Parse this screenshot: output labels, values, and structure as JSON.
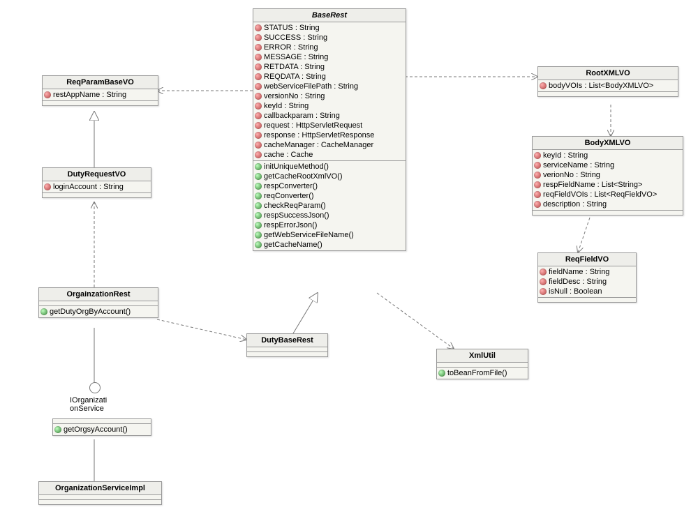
{
  "classes": {
    "BaseRest": {
      "name": "BaseRest",
      "italic": true,
      "attrs": [
        {
          "n": "STATUS",
          "t": "String"
        },
        {
          "n": "SUCCESS",
          "t": "String"
        },
        {
          "n": "ERROR",
          "t": "String"
        },
        {
          "n": "MESSAGE",
          "t": "String"
        },
        {
          "n": "RETDATA",
          "t": "String"
        },
        {
          "n": "REQDATA",
          "t": "String"
        },
        {
          "n": "webServiceFilePath",
          "t": "String"
        },
        {
          "n": "versionNo",
          "t": "String"
        },
        {
          "n": "keyId",
          "t": "String"
        },
        {
          "n": "callbackparam",
          "t": "String"
        },
        {
          "n": "request",
          "t": "HttpServletRequest"
        },
        {
          "n": "response",
          "t": "HttpServletResponse"
        },
        {
          "n": "cacheManager",
          "t": "CacheManager"
        },
        {
          "n": "cache",
          "t": "Cache"
        }
      ],
      "methods": [
        "initUniqueMethod()",
        "getCacheRootXmlVO()",
        "respConverter()",
        "reqConverter()",
        "checkReqParam()",
        "respSuccessJson()",
        "respErrorJson()",
        "getWebServiceFileName()",
        "getCacheName()"
      ]
    },
    "ReqParamBaseVO": {
      "name": "ReqParamBaseVO",
      "attrs": [
        {
          "n": "restAppName",
          "t": "String"
        }
      ],
      "methods": []
    },
    "DutyRequestVO": {
      "name": "DutyRequestVO",
      "attrs": [
        {
          "n": "loginAccount",
          "t": "String"
        }
      ],
      "methods": []
    },
    "OrgainzationRest": {
      "name": "OrgainzationRest",
      "attrs": [],
      "methods": [
        "getDutyOrgByAccount()"
      ]
    },
    "DutyBaseRest": {
      "name": "DutyBaseRest",
      "attrs": [],
      "methods": []
    },
    "XmlUtil": {
      "name": "XmlUtil",
      "attrs": [],
      "methods": [
        "toBeanFromFile()"
      ]
    },
    "RootXMLVO": {
      "name": "RootXMLVO",
      "attrs": [
        {
          "n": "bodyVOIs",
          "t": "List<BodyXMLVO>"
        }
      ],
      "methods": []
    },
    "BodyXMLVO": {
      "name": "BodyXMLVO",
      "attrs": [
        {
          "n": "keyId",
          "t": "String"
        },
        {
          "n": "serviceName",
          "t": "String"
        },
        {
          "n": "verionNo",
          "t": "String"
        },
        {
          "n": "respFieldName",
          "t": "List<String>"
        },
        {
          "n": "reqFieldVOIs",
          "t": "List<ReqFieldVO>"
        },
        {
          "n": "description",
          "t": "String"
        }
      ],
      "methods": []
    },
    "ReqFieldVO": {
      "name": "ReqFieldVO",
      "attrs": [
        {
          "n": "fieldName",
          "t": "String"
        },
        {
          "n": "fieldDesc",
          "t": "String"
        },
        {
          "n": "isNull",
          "t": "Boolean"
        }
      ],
      "methods": []
    },
    "IOrganizationService": {
      "name": "IOrganizati onService",
      "methods": [
        "getOrgsyAccount()"
      ]
    },
    "OrganizationServiceImpl": {
      "name": "OrganizationServiceImpl",
      "attrs": [],
      "methods": []
    }
  }
}
